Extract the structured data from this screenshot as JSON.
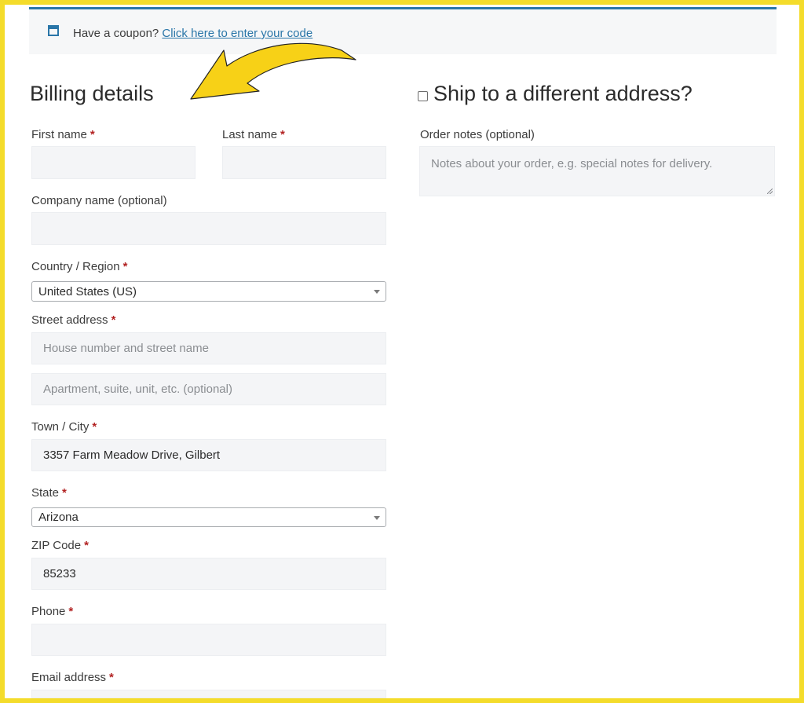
{
  "notice": {
    "text": "Have a coupon?",
    "link": "Click here to enter your code"
  },
  "billing": {
    "title": "Billing details",
    "required_marker": "*",
    "first_name_label": "First name",
    "last_name_label": "Last name",
    "company_label": "Company name (optional)",
    "country_label": "Country / Region",
    "country_value": "United States (US)",
    "street_label": "Street address",
    "street_placeholder_1": "House number and street name",
    "street_placeholder_2": "Apartment, suite, unit, etc. (optional)",
    "city_label": "Town / City",
    "city_value": "3357 Farm Meadow Drive, Gilbert",
    "state_label": "State",
    "state_value": "Arizona",
    "zip_label": "ZIP Code",
    "zip_value": "85233",
    "phone_label": "Phone",
    "email_label": "Email address"
  },
  "shipping": {
    "title": "Ship to a different address?",
    "checked": false
  },
  "order_notes": {
    "label": "Order notes (optional)",
    "placeholder": "Notes about your order, e.g. special notes for delivery."
  },
  "colors": {
    "frame": "#f4dc2b",
    "accent": "#2a76a8",
    "required": "#b22222",
    "field_bg": "#f4f5f7",
    "arrow": "#f7d117"
  }
}
